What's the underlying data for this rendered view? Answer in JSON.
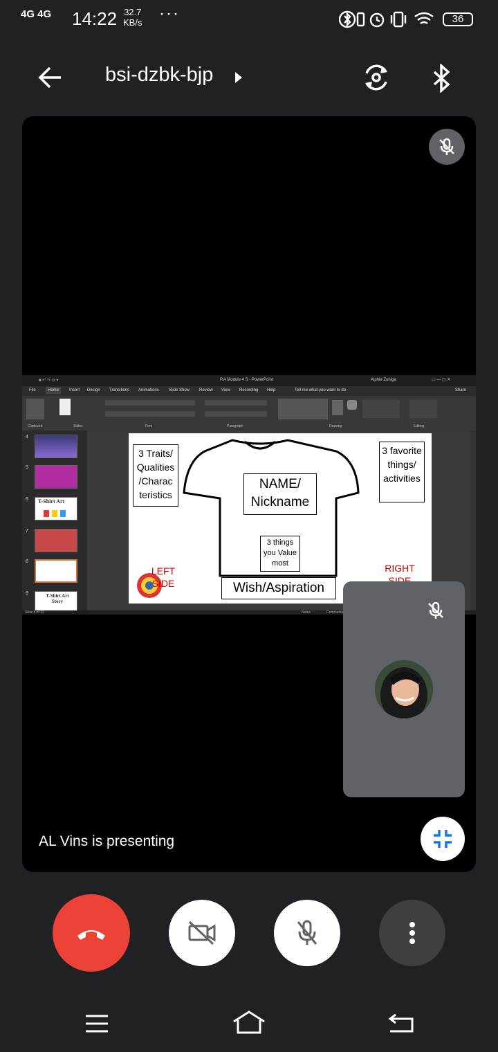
{
  "status_bar": {
    "network": "4G 4G",
    "time": "14:22",
    "speed_value": "32.7",
    "speed_unit": "KB/s",
    "more": "···",
    "battery": "36"
  },
  "header": {
    "meeting_code": "bsi-dzbk-bjp"
  },
  "presentation": {
    "presenter_text": "AL Vins is presenting",
    "app_title": "P.A Module 4 S - PowerPoint",
    "user_name": "Alphie Zuniga",
    "tabs": [
      "File",
      "Home",
      "Insert",
      "Design",
      "Transitions",
      "Animations",
      "Slide Show",
      "Review",
      "View",
      "Recording",
      "Help"
    ],
    "tell_me": "Tell me what you want to do",
    "share": "Share",
    "groups": [
      "Clipboard",
      "Slides",
      "Font",
      "Paragraph",
      "Drawing",
      "Editing"
    ],
    "thumb_numbers": [
      "4",
      "5",
      "6",
      "7",
      "8",
      "9"
    ],
    "thumb6_title": "T-Shirt Art",
    "thumb9_title": "T-Shirt Art Story",
    "slide_counter": "Slide 8 of 22",
    "notes": "Notes",
    "comments": "Comments",
    "slide": {
      "traits": "3 Traits/ Qualities /Charac teristics",
      "favorite": "3 favorite things/ activities",
      "name": "NAME/ Nickname",
      "values": "3 things you Value most",
      "wish": "Wish/Aspiration",
      "left_side": "LEFT SIDE",
      "right_side": "RIGHT SIDE"
    }
  },
  "colors": {
    "end_call": "#ea4335",
    "background": "#202124",
    "tile_gray": "#5f6368",
    "accent_blue": "#1a73e8"
  }
}
